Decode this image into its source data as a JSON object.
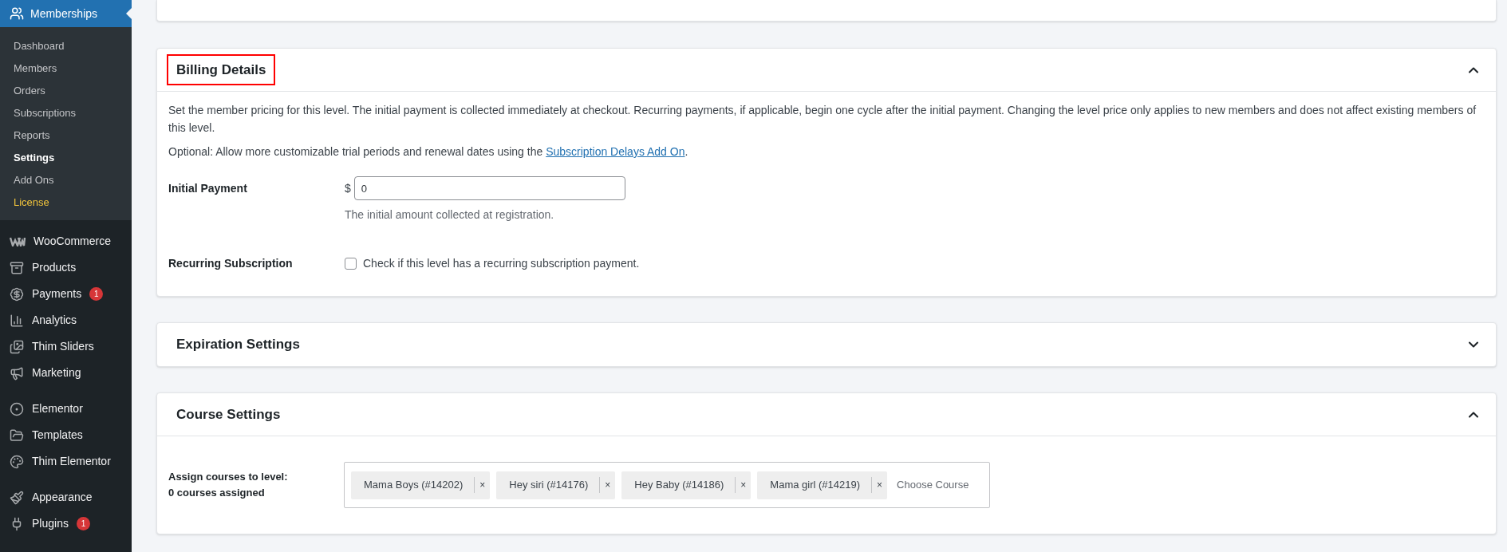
{
  "sidebar": {
    "header": {
      "label": "Memberships",
      "selected": true
    },
    "submenu": [
      {
        "label": "Dashboard",
        "selected": false,
        "color": "#c3c4c7"
      },
      {
        "label": "Members",
        "selected": false,
        "color": "#c3c4c7"
      },
      {
        "label": "Orders",
        "selected": false,
        "color": "#c3c4c7"
      },
      {
        "label": "Subscriptions",
        "selected": false,
        "color": "#c3c4c7"
      },
      {
        "label": "Reports",
        "selected": false,
        "color": "#c3c4c7"
      },
      {
        "label": "Settings",
        "selected": true,
        "color": "#ffffff"
      },
      {
        "label": "Add Ons",
        "selected": false,
        "color": "#c3c4c7"
      },
      {
        "label": "License",
        "selected": false,
        "color": "#f0c33c"
      }
    ],
    "groups": [
      [
        {
          "label": "WooCommerce"
        },
        {
          "label": "Products"
        },
        {
          "label": "Payments",
          "badge": "1"
        },
        {
          "label": "Analytics"
        },
        {
          "label": "Thim Sliders"
        },
        {
          "label": "Marketing"
        }
      ],
      [
        {
          "label": "Elementor"
        },
        {
          "label": "Templates"
        },
        {
          "label": "Thim Elementor"
        }
      ],
      [
        {
          "label": "Appearance"
        },
        {
          "label": "Plugins",
          "badge": "1"
        }
      ]
    ]
  },
  "sections": [
    {
      "kind": "billing",
      "title": "Billing Details",
      "expanded": true,
      "highlighted": true,
      "description": "Set the member pricing for this level. The initial payment is collected immediately at checkout. Recurring payments, if applicable, begin one cycle after the initial payment. Changing the level price only applies to new members and does not affect existing members of this level.",
      "optional_text": "Optional: Allow more customizable trial periods and renewal dates using the",
      "optional_link": "Subscription Delays Add On",
      "optional_end": ".",
      "initial_payment": {
        "label": "Initial Payment",
        "currency": "$",
        "value": "0",
        "hint": "The initial amount collected at registration."
      },
      "recurring": {
        "label": "Recurring Subscription",
        "checked": false,
        "text": "Check if this level has a recurring subscription payment."
      }
    },
    {
      "title": "Expiration Settings",
      "expanded": false,
      "highlighted": false
    },
    {
      "kind": "courses",
      "title": "Course Settings",
      "expanded": true,
      "highlighted": false,
      "label": "Assign courses to level:",
      "count": "0 courses assigned",
      "tags": [
        {
          "label": "Mama Boys (#14202)",
          "remove": "×"
        },
        {
          "label": "Hey siri (#14176)",
          "remove": "×"
        },
        {
          "label": "Hey Baby (#14186)",
          "remove": "×"
        },
        {
          "label": "Mama girl (#14219)",
          "remove": "×"
        }
      ],
      "placeholder": "Choose Course"
    }
  ]
}
